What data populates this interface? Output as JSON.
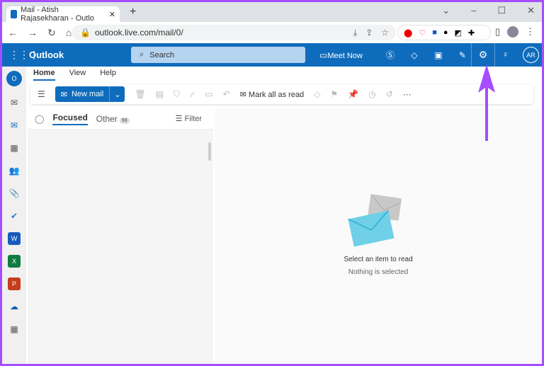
{
  "browser": {
    "tab_title": "Mail - Atish Rajasekharan - Outlo",
    "url": "outlook.live.com/mail/0/"
  },
  "header": {
    "brand": "Outlook",
    "search_placeholder": "Search",
    "meet_now": "Meet Now",
    "avatar_initials": "AR"
  },
  "ribbon": {
    "tabs": [
      "Home",
      "View",
      "Help"
    ],
    "new_mail": "New mail",
    "mark_all_read": "Mark all as read",
    "more": "···"
  },
  "list": {
    "focused": "Focused",
    "other": "Other",
    "other_count": "98",
    "filter": "Filter"
  },
  "reading": {
    "title": "Select an item to read",
    "subtitle": "Nothing is selected"
  },
  "colors": {
    "brand": "#0f6cbd",
    "annotation_arrow": "#a64dff"
  }
}
